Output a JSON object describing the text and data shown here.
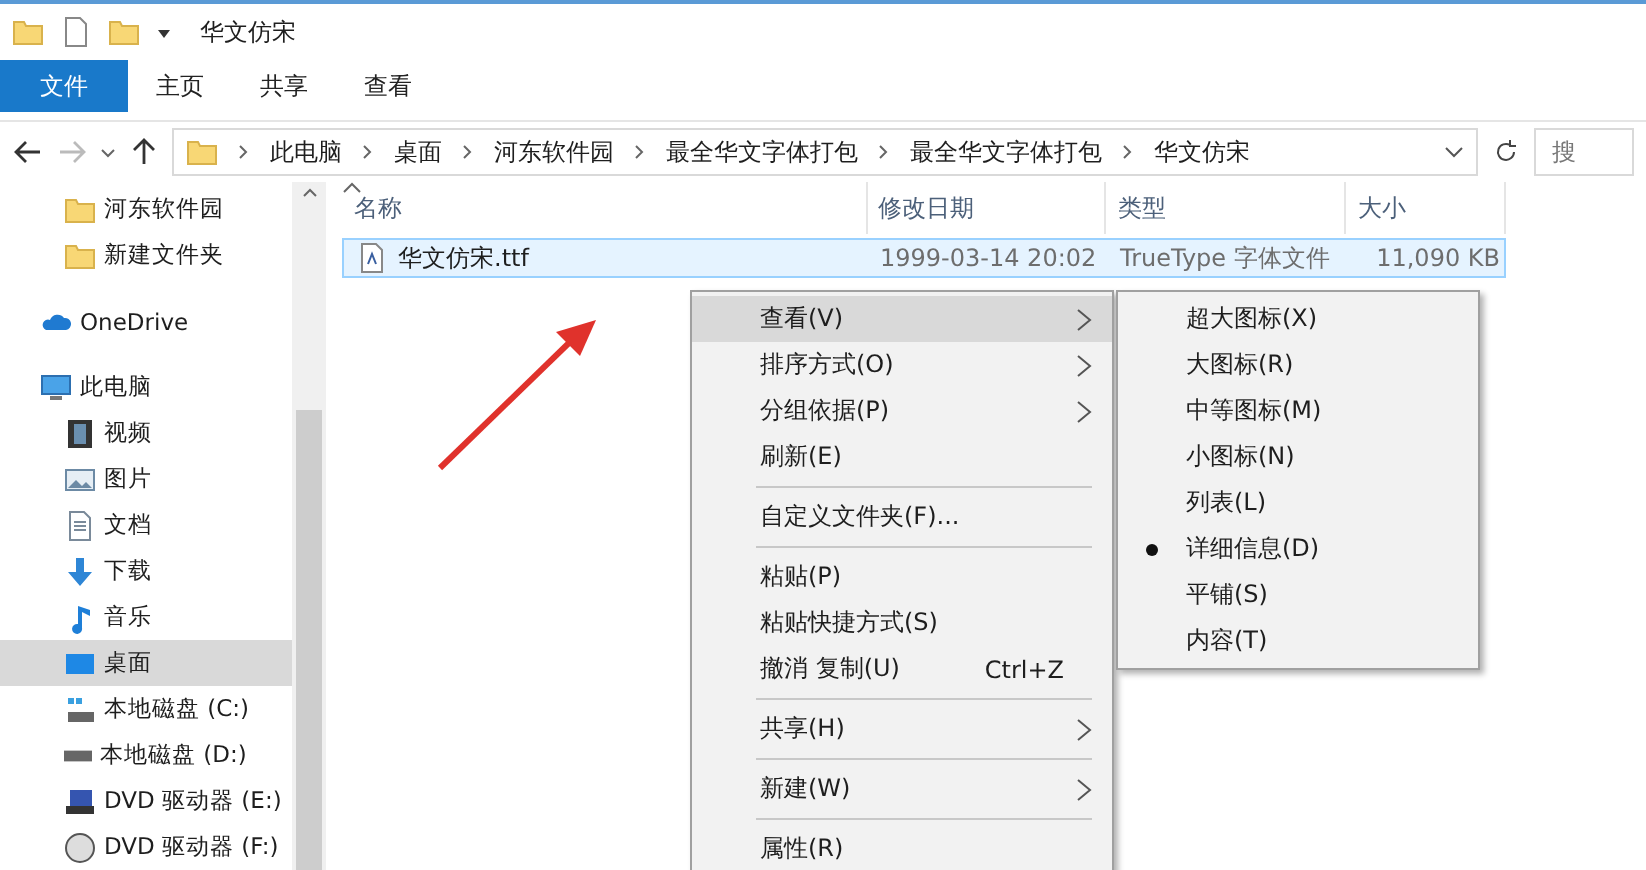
{
  "title_bar": {
    "title": "华文仿宋"
  },
  "ribbon_tabs": [
    {
      "label": "文件",
      "selected": true
    },
    {
      "label": "主页",
      "selected": false
    },
    {
      "label": "共享",
      "selected": false
    },
    {
      "label": "查看",
      "selected": false
    }
  ],
  "address_bar": {
    "path": [
      "此电脑",
      "桌面",
      "河东软件园",
      "最全华文字体打包",
      "最全华文字体打包",
      "华文仿宋"
    ]
  },
  "search": {
    "placeholder": "搜"
  },
  "sidebar": {
    "quick_access_items": [
      {
        "label": "河东软件园",
        "kind": "folder",
        "selected": false
      },
      {
        "label": "新建文件夹",
        "kind": "folder",
        "selected": false
      }
    ],
    "items": [
      {
        "label": "OneDrive",
        "kind": "cloud",
        "selected": false
      },
      {
        "label": "此电脑",
        "kind": "pc",
        "selected": false,
        "children": [
          {
            "label": "视频",
            "kind": "video",
            "selected": false
          },
          {
            "label": "图片",
            "kind": "picture",
            "selected": false
          },
          {
            "label": "文档",
            "kind": "document",
            "selected": false
          },
          {
            "label": "下载",
            "kind": "download",
            "selected": false
          },
          {
            "label": "音乐",
            "kind": "music",
            "selected": false
          },
          {
            "label": "桌面",
            "kind": "desktop",
            "selected": true
          },
          {
            "label": "本地磁盘 (C:)",
            "kind": "system-disk",
            "selected": false
          },
          {
            "label": "本地磁盘 (D:)",
            "kind": "disk",
            "selected": false
          },
          {
            "label": "DVD 驱动器 (E:)",
            "kind": "dvd",
            "selected": false
          },
          {
            "label": "DVD 驱动器 (F:)",
            "kind": "dvd-disc",
            "selected": false
          }
        ]
      }
    ]
  },
  "table": {
    "columns": [
      "名称",
      "修改日期",
      "类型",
      "大小"
    ],
    "rows": [
      {
        "cells": [
          "华文仿宋.ttf",
          "1999-03-14 20:02",
          "TrueType 字体文件",
          "11,090 KB"
        ],
        "selected": true
      }
    ]
  },
  "context_menu": {
    "items": [
      {
        "kind": "item",
        "label": "查看(V)",
        "submenu": true,
        "highlighted": true
      },
      {
        "kind": "item",
        "label": "排序方式(O)",
        "submenu": true,
        "highlighted": false
      },
      {
        "kind": "item",
        "label": "分组依据(P)",
        "submenu": true,
        "highlighted": false
      },
      {
        "kind": "item",
        "label": "刷新(E)",
        "submenu": false,
        "highlighted": false
      },
      {
        "kind": "separator"
      },
      {
        "kind": "item",
        "label": "自定义文件夹(F)...",
        "submenu": false,
        "highlighted": false
      },
      {
        "kind": "separator"
      },
      {
        "kind": "item",
        "label": "粘贴(P)",
        "submenu": false,
        "highlighted": false
      },
      {
        "kind": "item",
        "label": "粘贴快捷方式(S)",
        "submenu": false,
        "highlighted": false
      },
      {
        "kind": "item",
        "label": "撤消 复制(U)",
        "shortcut": "Ctrl+Z",
        "submenu": false,
        "highlighted": false
      },
      {
        "kind": "separator"
      },
      {
        "kind": "item",
        "label": "共享(H)",
        "submenu": true,
        "highlighted": false
      },
      {
        "kind": "separator"
      },
      {
        "kind": "item",
        "label": "新建(W)",
        "submenu": true,
        "highlighted": false
      },
      {
        "kind": "separator"
      },
      {
        "kind": "item",
        "label": "属性(R)",
        "submenu": false,
        "highlighted": false
      }
    ]
  },
  "view_submenu": {
    "items": [
      {
        "label": "超大图标(X)",
        "checked": false
      },
      {
        "label": "大图标(R)",
        "checked": false
      },
      {
        "label": "中等图标(M)",
        "checked": false
      },
      {
        "label": "小图标(N)",
        "checked": false
      },
      {
        "label": "列表(L)",
        "checked": false
      },
      {
        "label": "详细信息(D)",
        "checked": true
      },
      {
        "label": "平铺(S)",
        "checked": false
      },
      {
        "label": "内容(T)",
        "checked": false
      }
    ]
  },
  "annotation": {
    "kind": "arrow"
  }
}
